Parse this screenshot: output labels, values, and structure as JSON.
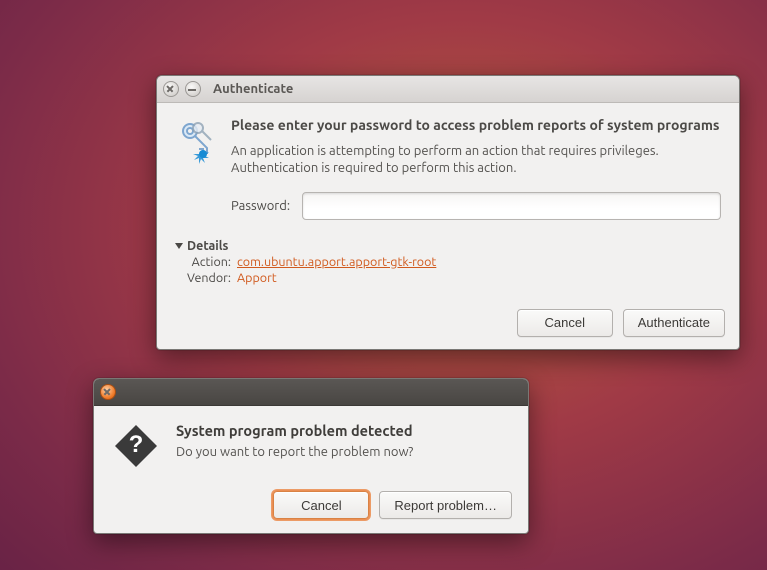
{
  "auth_dialog": {
    "window_title": "Authenticate",
    "heading": "Please enter your password to access problem reports of system programs",
    "description": "An application is attempting to perform an action that requires privileges. Authentication is required to perform this action.",
    "password_label": "Password:",
    "password_value": "",
    "details_label": "Details",
    "action_key": "Action:",
    "action_value": "com.ubuntu.apport.apport-gtk-root",
    "vendor_key": "Vendor:",
    "vendor_value": "Apport",
    "cancel_label": "Cancel",
    "authenticate_label": "Authenticate"
  },
  "apport_dialog": {
    "heading": "System program problem detected",
    "description": "Do you want to report the problem now?",
    "cancel_label": "Cancel",
    "report_label": "Report problem…"
  },
  "colors": {
    "accent": "#e8732e",
    "link": "#d15a1e"
  }
}
